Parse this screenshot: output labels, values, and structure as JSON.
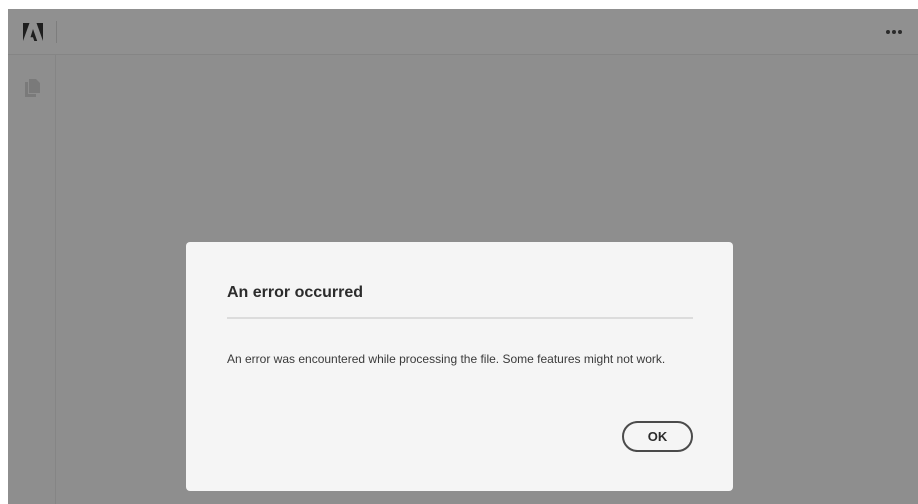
{
  "app": {
    "logo_icon": "adobe-logo-icon",
    "more_icon": "more-horizontal-icon",
    "pages_icon": "pages-icon",
    "colors": {
      "backdrop": "#8e8e8e",
      "dialog_bg": "#f5f5f5",
      "text": "#2c2c2c"
    }
  },
  "dialog": {
    "title": "An error occurred",
    "message": "An error was encountered while processing the file. Some features might not work.",
    "ok_label": "OK"
  }
}
